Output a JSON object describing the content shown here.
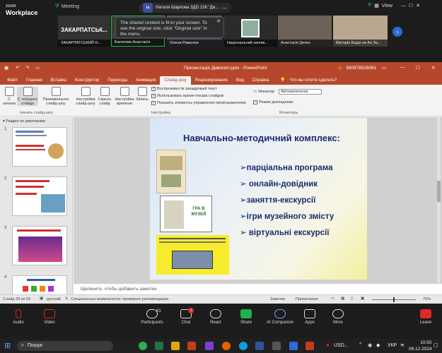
{
  "zoom": {
    "logo_top": "zoom",
    "logo_bottom": "Workplace",
    "meeting_label": "Meeting",
    "presenter_badge": "Н",
    "presenter_text": "Наталя Шарлова ЗДО 226 \"Ди...",
    "view_label": "View",
    "tip_text": "The shared content is fit to your screen. To see the original size, click \"Original size\" in the menu.",
    "tile_names": [
      "ЗАКАРПАТСЬКИЙ О...",
      "Балогова Анастасія",
      "Олена Рамснюк",
      "Національний запові...",
      "Анастасія Деяко",
      "Вікторія Бодзі ни Ан За..."
    ],
    "tile_header_text": "ЗАКАРПАТСЬК...",
    "controls": [
      {
        "label": "Audio",
        "icon": "microphone-icon"
      },
      {
        "label": "Video",
        "icon": "video-icon"
      },
      {
        "label": "Participants",
        "icon": "participants-icon",
        "count": "81"
      },
      {
        "label": "Chat",
        "icon": "chat-icon",
        "count": "1"
      },
      {
        "label": "React",
        "icon": "heart-icon"
      },
      {
        "label": "Share",
        "icon": "share-icon"
      },
      {
        "label": "AI Companion",
        "icon": "sparkle-icon"
      },
      {
        "label": "Apps",
        "icon": "apps-icon"
      },
      {
        "label": "More",
        "icon": "more-icon"
      },
      {
        "label": "Leave",
        "icon": "leave-icon"
      }
    ]
  },
  "powerpoint": {
    "window_title": "Презентація Дивосвіт.pptx - PowerPoint",
    "account_text": "380978526061",
    "tabs": [
      "Файл",
      "Главная",
      "Вставка",
      "Конструктор",
      "Переходы",
      "Анимация",
      "Слайд-шоу",
      "Рецензирование",
      "Вид",
      "Справка"
    ],
    "active_tab": "Слайд-шоу",
    "tell_me": "Что вы хотите сделать?",
    "ribbon": {
      "buttons": [
        "С начала",
        "С текущего слайда",
        "Произвольное слайд-шоу",
        "Настройка слайд-шоу",
        "Скрыть слайд",
        "Настройка времени",
        "Запись"
      ],
      "group_start": "Начать слайд-шоу",
      "group_setup": "Настройка",
      "group_monitors": "Мониторы",
      "checkboxes": [
        "Воспроизвести закадровый текст",
        "Использовать время показа слайдов",
        "Показать элементы управления проигрывателем"
      ],
      "monitor_label": "Монитор:",
      "monitor_value": "Автоматически",
      "presenter_view": "Режим докладчика"
    },
    "section_label": "Раздел по умолчанию",
    "slide_numbers": [
      "1",
      "2",
      "3",
      "4"
    ],
    "slide": {
      "title": "Навчально-методичний комплекс:",
      "bullets": [
        "➢парціальна програма",
        "➢ онлайн-довідник",
        "➢заняття-екскурсії",
        "➢ігри музейного змісту",
        "➢ віртуальні екскурсії"
      ],
      "book_text": "ГРА В МУЗЕЙ"
    },
    "notes_placeholder": "Щелкните, чтобы добавить заметки",
    "status": {
      "slide_info": "Слайд 28 из 59",
      "language": "русский",
      "accessibility": "Специальные возможности: проверьте рекомендации",
      "notes_btn": "Заметки",
      "comments_btn": "Примечания",
      "zoom_level": "70%"
    }
  },
  "taskbar": {
    "search_placeholder": "Пошук",
    "currency": "USD...",
    "language": "УКР",
    "time": "10:50",
    "date": "06.12.2024"
  },
  "colors": {
    "ppt_red": "#b7472a",
    "slide_text": "#1a2a6e",
    "zoom_bg": "#1c1c1c",
    "leave_red": "#e02828",
    "share_green": "#23b14d"
  }
}
